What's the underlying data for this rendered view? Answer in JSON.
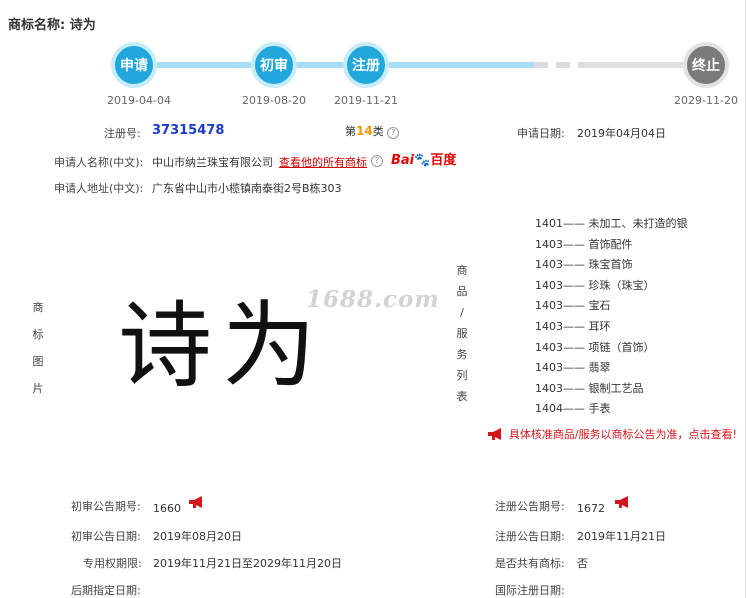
{
  "header": {
    "label": "商标名称:",
    "name": "诗为"
  },
  "timeline": {
    "steps": [
      {
        "label": "申请",
        "date": "2019-04-04"
      },
      {
        "label": "初审",
        "date": "2019-08-20"
      },
      {
        "label": "注册",
        "date": "2019-11-21"
      },
      {
        "label": "终止",
        "date": "2029-11-20"
      }
    ],
    "colors": {
      "active": "#21a7dc",
      "inactive": "#7b7b7b"
    }
  },
  "info": {
    "reg_no_label": "注册号:",
    "reg_no": "37315478",
    "class_prefix": "第",
    "class_num": "14",
    "class_suffix": "类",
    "apply_date_label": "申请日期:",
    "apply_date": "2019年04月04日",
    "applicant_label": "申请人名称(中文):",
    "applicant": "中山市纳兰珠宝有限公司",
    "see_all_link": "查看他的所有商标",
    "baidu_bai": "Bai",
    "baidu_du": "百度",
    "address_label": "申请人地址(中文):",
    "address": "广东省中山市小榄镇南泰街2号B栋303"
  },
  "trademark_image": {
    "side_label": [
      "商",
      "标",
      "图",
      "片"
    ],
    "text": "诗为",
    "watermark": "1688.com"
  },
  "goods": {
    "side_label": [
      "商",
      "品",
      "/",
      "服",
      "务",
      "列",
      "表"
    ],
    "items": [
      {
        "code": "1401",
        "name": "未加工、未打造的银"
      },
      {
        "code": "1403",
        "name": "首饰配件"
      },
      {
        "code": "1403",
        "name": "珠宝首饰"
      },
      {
        "code": "1403",
        "name": "珍珠（珠宝）"
      },
      {
        "code": "1403",
        "name": "宝石"
      },
      {
        "code": "1403",
        "name": "耳环"
      },
      {
        "code": "1403",
        "name": "项链（首饰）"
      },
      {
        "code": "1403",
        "name": "翡翠"
      },
      {
        "code": "1403",
        "name": "银制工艺品"
      },
      {
        "code": "1404",
        "name": "手表"
      }
    ],
    "separator": "——",
    "notice": "具体核准商品/服务以商标公告为准，点击查看!"
  },
  "bulletin": {
    "prelim_no_label": "初审公告期号:",
    "prelim_no": "1660",
    "reg_no_label": "注册公告期号:",
    "reg_no": "1672",
    "prelim_date_label": "初审公告日期:",
    "prelim_date": "2019年08月20日",
    "reg_date_label": "注册公告日期:",
    "reg_date": "2019年11月21日",
    "exclusive_label": "专用权期限:",
    "exclusive": "2019年11月21日至2029年11月20日",
    "shared_label": "是否共有商标:",
    "shared": "否",
    "later_label": "后期指定日期:",
    "intl_label": "国际注册日期:"
  }
}
